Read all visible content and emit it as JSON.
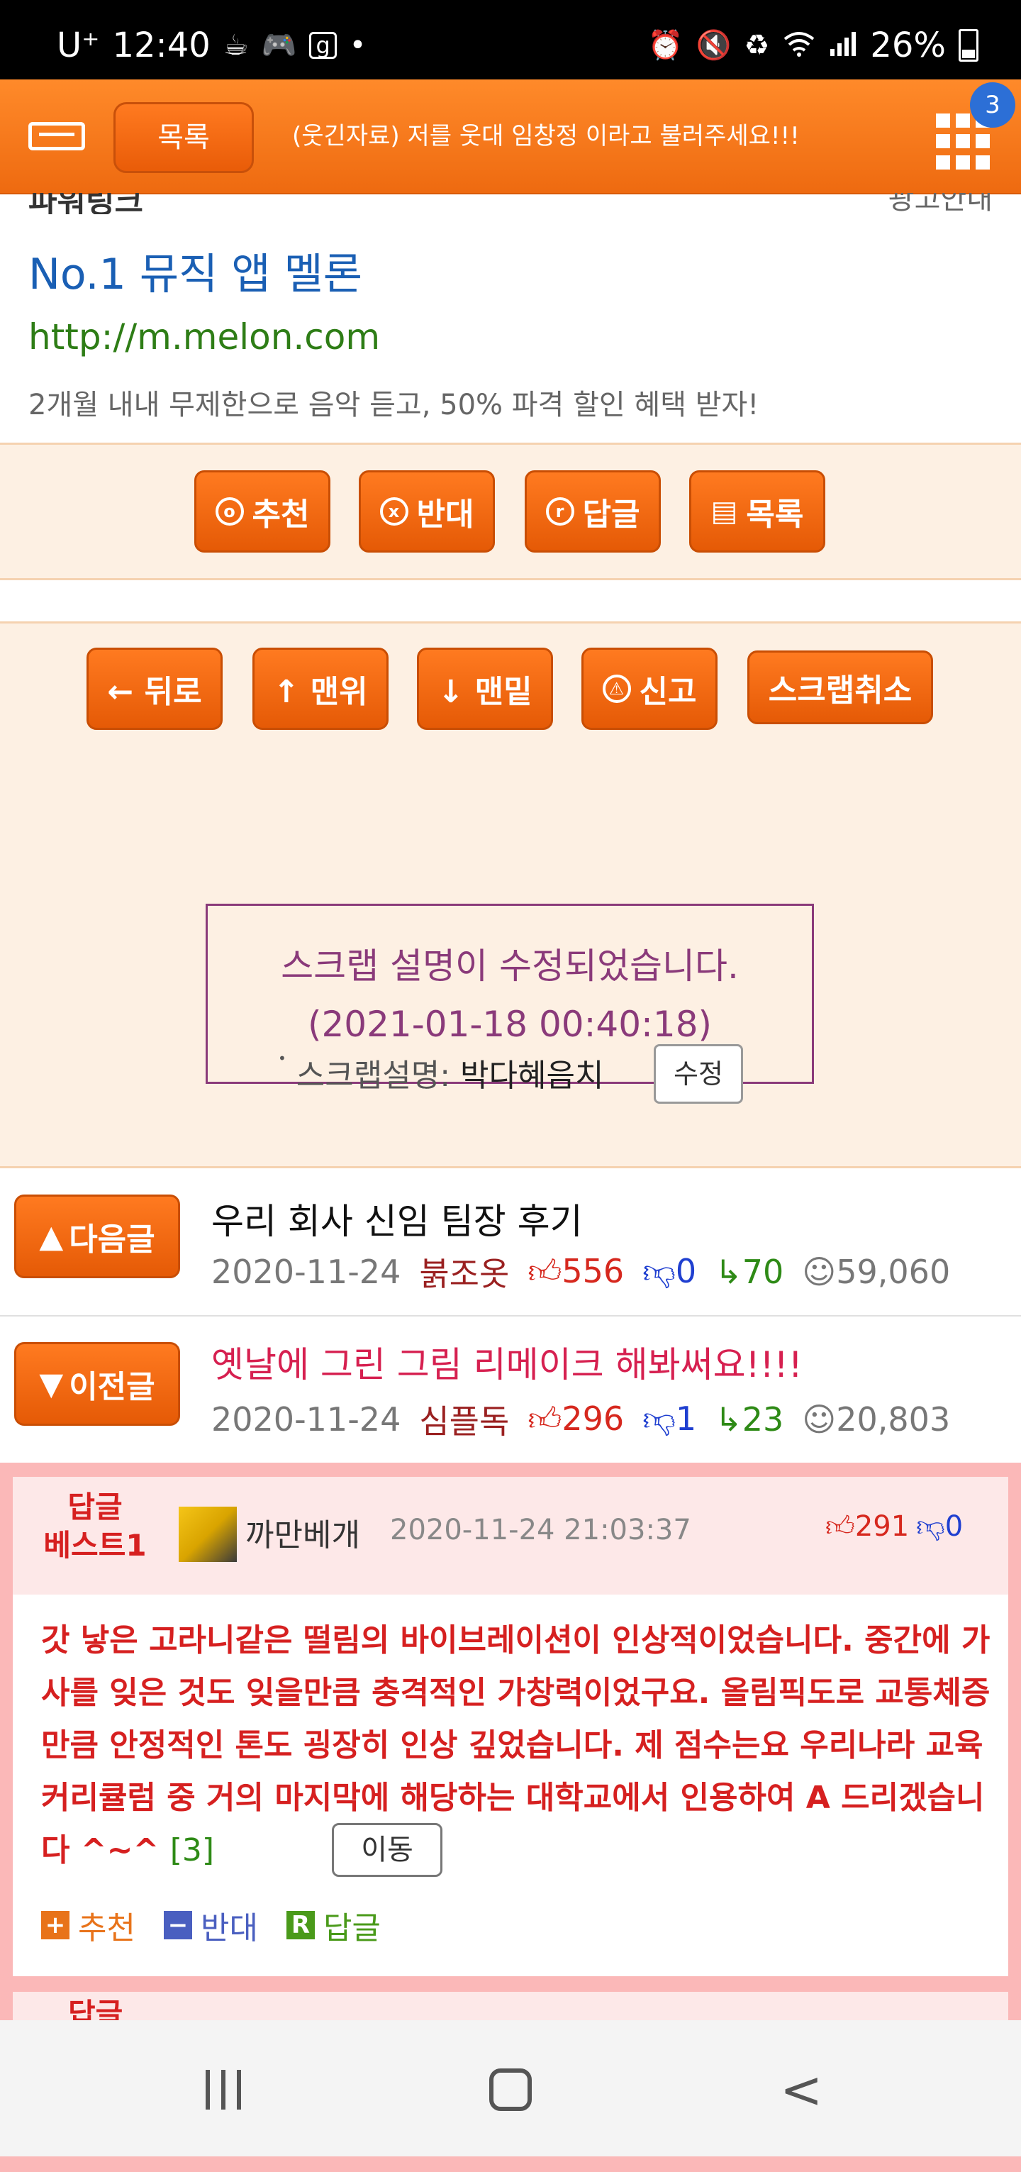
{
  "status_bar": {
    "carrier": "U⁺",
    "time": "12:40",
    "battery": "26%",
    "icons_left": [
      "coffee-icon",
      "game-icon",
      "g-app-icon",
      "dot-icon"
    ],
    "icons_right": [
      "alarm-icon",
      "mute-icon",
      "battery-saver-icon",
      "wifi-icon",
      "signal-icon",
      "battery-icon"
    ]
  },
  "top_bar": {
    "list_label": "목록",
    "title": "(웃긴자료) 저를 웃대 임창정 이라고 불러주세요!!!",
    "notification_count": "3",
    "accent": "#f07418"
  },
  "ad": {
    "partial_left": "파워링크",
    "partial_right": "광고안내",
    "title": "No.1 뮤직 앱 멜론",
    "url": "http://m.melon.com",
    "description": "2개월 내내 무제한으로 음악 듣고, 50% 파격 할인 혜택 받자!"
  },
  "post_actions": {
    "recommend": "추천",
    "oppose": "반대",
    "reply": "답글",
    "list": "목록"
  },
  "nav_actions": {
    "back": "← 뒤로",
    "top": "↑ 맨위",
    "bottom": "↓ 맨밑",
    "report": "신고",
    "unscrap": "스크랩취소"
  },
  "scrap": {
    "message_line1": "스크랩 설명이 수정되었습니다.",
    "message_line2": "(2021-01-18 00:40:18)",
    "desc_label": "스크랩설명:",
    "desc_value": "박다혜음치",
    "edit_label": "수정"
  },
  "next_post": {
    "button": "다음글",
    "title": "우리 회사 신임 팀장 후기",
    "date": "2020-11-24",
    "author": "붉조옷",
    "up": "556",
    "down": "0",
    "replies": "70",
    "views": "59,060"
  },
  "prev_post": {
    "button": "이전글",
    "title": "옛날에 그린 그림 리메이크 해봐써요!!!!",
    "date": "2020-11-24",
    "author": "심플독",
    "up": "296",
    "down": "1",
    "replies": "23",
    "views": "20,803"
  },
  "best_reply": {
    "label_line1": "답글",
    "label_line2": "베스트1",
    "author": "까만베개",
    "datetime": "2020-11-24 21:03:37",
    "up": "291",
    "down": "0",
    "text": "갓 낳은 고라니같은 떨림의 바이브레이션이 인상적이었습니다. 중간에 가사를 잊은 것도 잊을만큼 충격적인 가창력이었구요. 올림픽도로 교통체증만큼 안정적인 톤도 굉장히 인상 깊었습니다. 제 점수는요 우리나라 교육 커리큘럼 중 거의 마지막에 해당하는 대학교에서 인용하여 A 드리겠습니다 ^~^",
    "reply_count": "[3]",
    "move_label": "이동",
    "actions": {
      "recommend": "추천",
      "oppose": "반대",
      "reply": "답글"
    }
  },
  "best_reply2": {
    "label_partial": "답글"
  }
}
